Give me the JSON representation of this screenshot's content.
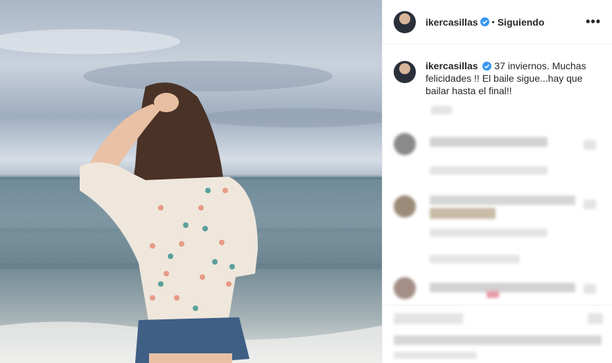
{
  "post": {
    "username": "ikercasillas",
    "follow_status": "Siguiendo",
    "separator": "•",
    "more_label": "•••"
  },
  "caption": {
    "username": "ikercasillas",
    "text": "37 inviernos. Muchas felicidades !! El baile sigue...hay que bailar hasta el final!!"
  },
  "colors": {
    "verified": "#3897f0",
    "text": "#262626",
    "border": "#efefef"
  }
}
